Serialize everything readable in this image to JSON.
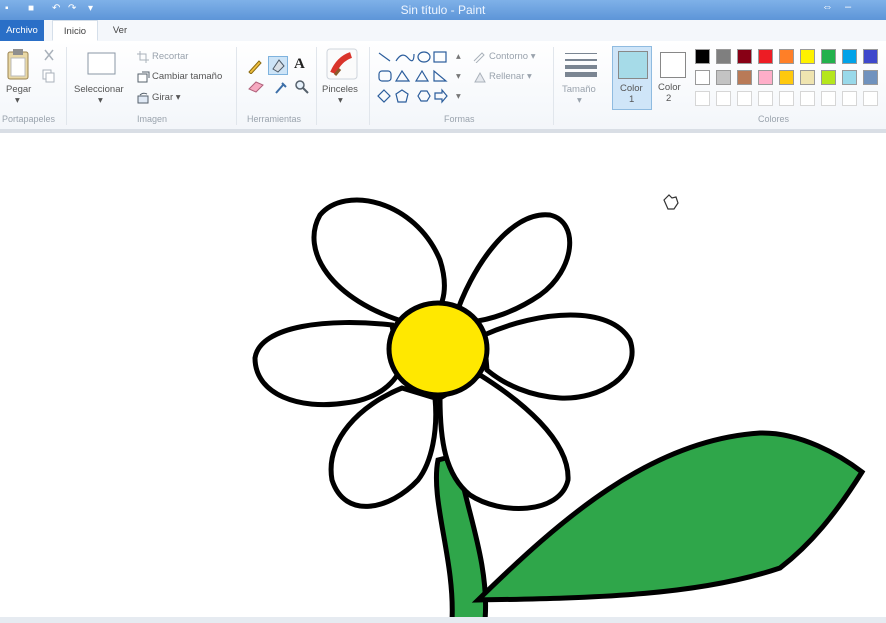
{
  "window": {
    "title": "Sin título - Paint"
  },
  "tabs": {
    "file": "Archivo",
    "home": "Inicio",
    "view": "Ver"
  },
  "clipboard": {
    "paste": "Pegar",
    "group": "Portapapeles"
  },
  "image": {
    "select": "Seleccionar",
    "crop": "Recortar",
    "resize": "Cambiar tamaño",
    "rotate": "Girar",
    "group": "Imagen"
  },
  "tools": {
    "group": "Herramientas"
  },
  "brushes": {
    "label": "Pinceles"
  },
  "shapes": {
    "outline": "Contorno",
    "fill": "Rellenar",
    "group": "Formas"
  },
  "size": {
    "label": "Tamaño"
  },
  "colors": {
    "color1": "Color",
    "color1_num": "1",
    "color2": "Color",
    "color2_num": "2",
    "group": "Colores",
    "color1_value": "#a6dbe8",
    "color2_value": "#ffffff",
    "palette_row1": [
      "#000000",
      "#7f7f7f",
      "#880015",
      "#ed1c24",
      "#ff7f27",
      "#fff200",
      "#22b14c",
      "#00a2e8",
      "#3f48cc",
      "#a349a4"
    ],
    "palette_row2": [
      "#ffffff",
      "#c3c3c3",
      "#b97a57",
      "#ffaec9",
      "#ffc90e",
      "#efe4b0",
      "#b5e61d",
      "#99d9ea",
      "#7092be",
      "#c8bfe7"
    ]
  },
  "drawing": {
    "petal_fill": "#ffffff",
    "center_fill": "#ffe800",
    "stem_fill": "#2fa64a",
    "outline": "#000000"
  }
}
